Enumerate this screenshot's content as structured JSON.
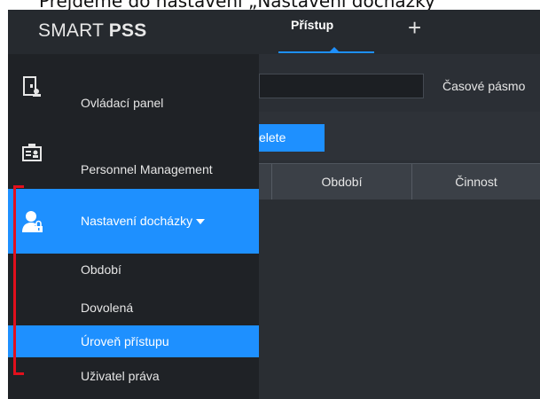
{
  "caption": {
    "text": "Přejděme do nastavení „Nastavení docházky”"
  },
  "topbar": {
    "logo_left": "SMART ",
    "logo_bold": "PSS",
    "active_tab": "Přístup",
    "add_tab": "+"
  },
  "sidebar": {
    "items": [
      {
        "label": "Ovládací panel",
        "icon": "control-panel-icon"
      },
      {
        "label": "Personnel Management",
        "icon": "id-card-icon"
      },
      {
        "label": "Nastavení docházky",
        "icon": "user-lock-icon",
        "active": true
      }
    ],
    "subitems": [
      {
        "label": "Období"
      },
      {
        "label": "Dovolená"
      },
      {
        "label": "Úroveň přístupu",
        "selected": true
      },
      {
        "label": "Uživatel práva"
      }
    ]
  },
  "content": {
    "timezone_label": "Časové pásmo",
    "delete_button": "elete",
    "columns": [
      "Období",
      "Činnost"
    ]
  },
  "colors": {
    "accent": "#1e90ff",
    "sidebar_bg": "#1f2226",
    "topbar_bg": "#262a2f",
    "annotation": "#e2101c"
  }
}
